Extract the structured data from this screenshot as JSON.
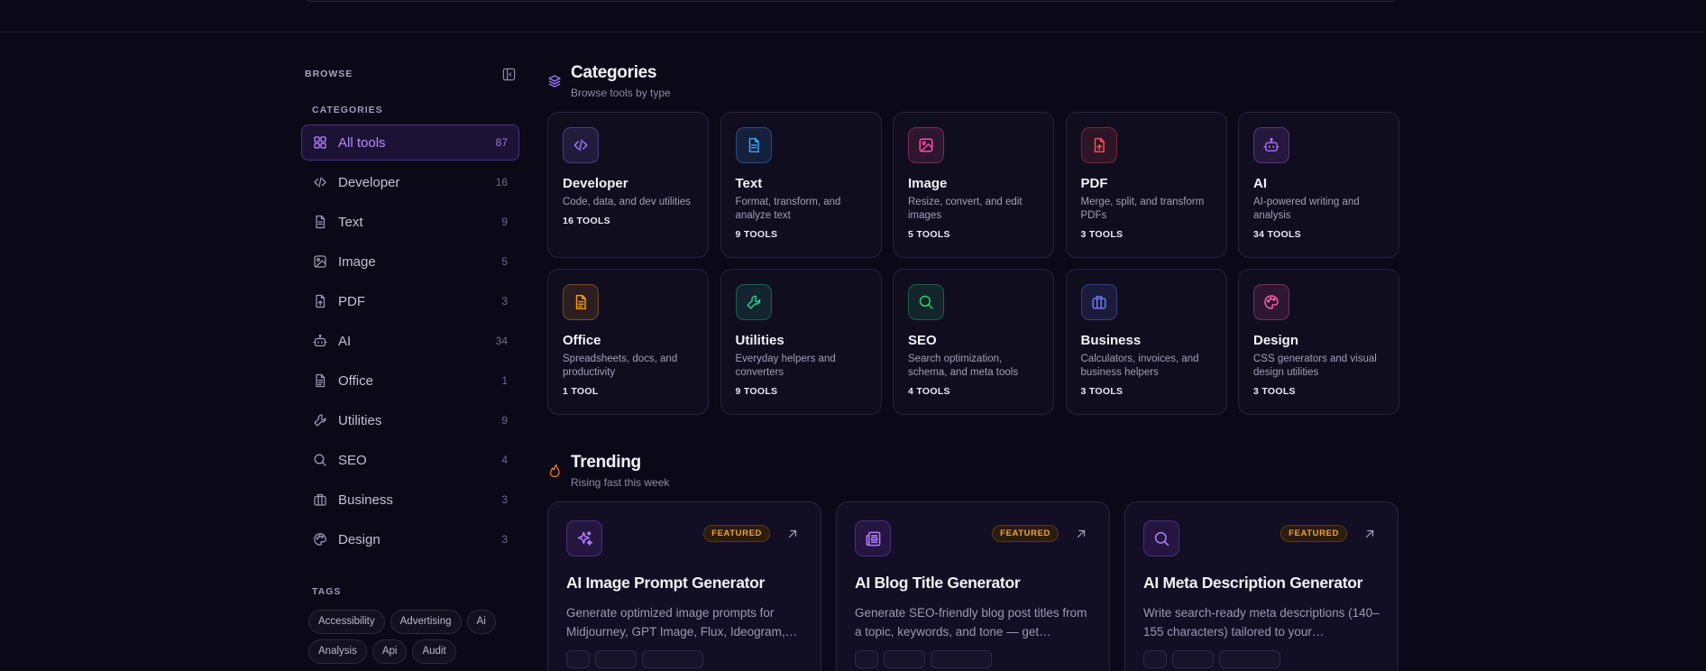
{
  "sidebar": {
    "browse_label": "BROWSE",
    "categories_label": "CATEGORIES",
    "categories": [
      {
        "label": "All tools",
        "count": "87",
        "icon": "grid-icon",
        "active": true
      },
      {
        "label": "Developer",
        "count": "16",
        "icon": "code-icon"
      },
      {
        "label": "Text",
        "count": "9",
        "icon": "document-icon"
      },
      {
        "label": "Image",
        "count": "5",
        "icon": "image-icon"
      },
      {
        "label": "PDF",
        "count": "3",
        "icon": "pdf-icon"
      },
      {
        "label": "AI",
        "count": "34",
        "icon": "robot-icon"
      },
      {
        "label": "Office",
        "count": "1",
        "icon": "office-document-icon"
      },
      {
        "label": "Utilities",
        "count": "9",
        "icon": "wrench-icon"
      },
      {
        "label": "SEO",
        "count": "4",
        "icon": "search-icon"
      },
      {
        "label": "Business",
        "count": "3",
        "icon": "briefcase-icon"
      },
      {
        "label": "Design",
        "count": "3",
        "icon": "palette-icon"
      }
    ],
    "tags_label": "TAGS",
    "tags": [
      "Accessibility",
      "Advertising",
      "Ai",
      "Analysis",
      "Api",
      "Audit"
    ]
  },
  "categories_section": {
    "title": "Categories",
    "subtitle": "Browse tools by type",
    "cards": [
      {
        "title": "Developer",
        "desc": "Code, data, and dev utilities",
        "count": "16 TOOLS",
        "icon": "code-icon",
        "color": "#9b7bff"
      },
      {
        "title": "Text",
        "desc": "Format, transform, and analyze text",
        "count": "9 TOOLS",
        "icon": "document-icon",
        "color": "#3ea6ff"
      },
      {
        "title": "Image",
        "desc": "Resize, convert, and edit images",
        "count": "5 TOOLS",
        "icon": "image-icon",
        "color": "#ff4fa3"
      },
      {
        "title": "PDF",
        "desc": "Merge, split, and transform PDFs",
        "count": "3 TOOLS",
        "icon": "pdf-icon",
        "color": "#ff4d57"
      },
      {
        "title": "AI",
        "desc": "AI-powered writing and analysis",
        "count": "34 TOOLS",
        "icon": "robot-icon",
        "color": "#b36bff"
      },
      {
        "title": "Office",
        "desc": "Spreadsheets, docs, and productivity",
        "count": "1 TOOL",
        "icon": "office-document-icon",
        "color": "#f59e2a"
      },
      {
        "title": "Utilities",
        "desc": "Everyday helpers and converters",
        "count": "9 TOOLS",
        "icon": "wrench-icon",
        "color": "#2ecc8f"
      },
      {
        "title": "SEO",
        "desc": "Search optimization, schema, and meta tools",
        "count": "4 TOOLS",
        "icon": "search-icon",
        "color": "#2ecc71"
      },
      {
        "title": "Business",
        "desc": "Calculators, invoices, and business helpers",
        "count": "3 TOOLS",
        "icon": "briefcase-icon",
        "color": "#6d7bff"
      },
      {
        "title": "Design",
        "desc": "CSS generators and visual design utilities",
        "count": "3 TOOLS",
        "icon": "palette-icon",
        "color": "#ff5fa8"
      }
    ]
  },
  "trending_section": {
    "title": "Trending",
    "subtitle": "Rising fast this week",
    "cards": [
      {
        "title": "AI Image Prompt Generator",
        "desc": "Generate optimized image prompts for Midjourney, GPT Image, Flux, Ideogram,…",
        "badge": "FEATURED",
        "icon": "sparkles-icon"
      },
      {
        "title": "AI Blog Title Generator",
        "desc": "Generate SEO-friendly blog post titles from a topic, keywords, and tone — get…",
        "badge": "FEATURED",
        "icon": "newspaper-icon"
      },
      {
        "title": "AI Meta Description Generator",
        "desc": "Write search-ready meta descriptions (140–155 characters) tailored to your…",
        "badge": "FEATURED",
        "icon": "search-icon"
      }
    ]
  },
  "colors": {
    "accent": "#b58cff",
    "background": "#0b0918",
    "featured": "#f0a437",
    "trending_icon": "#f07a2a",
    "categories_icon": "#9b7bff"
  }
}
